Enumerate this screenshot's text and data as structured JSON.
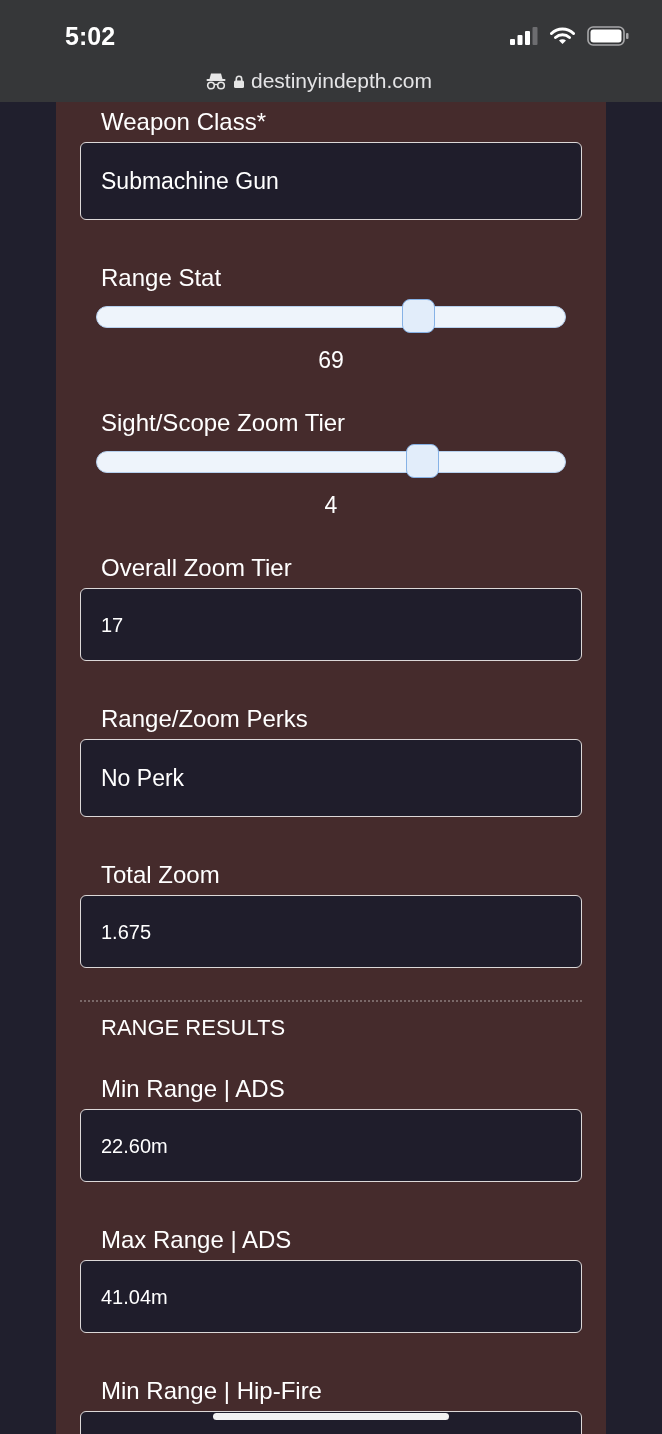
{
  "status_bar": {
    "time": "5:02"
  },
  "address_bar": {
    "incognito": true,
    "secure": true,
    "url": "destinyindepth.com"
  },
  "form": {
    "sections": [
      {
        "fields": [
          {
            "kind": "select",
            "label": "Weapon Class*",
            "value": "Submachine Gun"
          },
          {
            "kind": "slider",
            "label": "Range Stat",
            "level": 0.7,
            "reading": "69"
          },
          {
            "kind": "slider",
            "label": "Sight/Scope Zoom Tier",
            "level": 0.71,
            "reading": "4"
          },
          {
            "kind": "input",
            "label": "Overall Zoom Tier",
            "value": "17"
          },
          {
            "kind": "select",
            "label": "Range/Zoom Perks",
            "value": "No Perk"
          },
          {
            "kind": "input",
            "label": "Total Zoom",
            "value": "1.675"
          }
        ]
      },
      {
        "heading": "RANGE RESULTS",
        "fields": [
          {
            "kind": "input",
            "label": "Min Range | ADS",
            "value": "22.60m"
          },
          {
            "kind": "input",
            "label": "Max Range | ADS",
            "value": "41.04m"
          },
          {
            "kind": "input",
            "label": "Min Range | Hip-Fire"
          }
        ]
      }
    ]
  }
}
